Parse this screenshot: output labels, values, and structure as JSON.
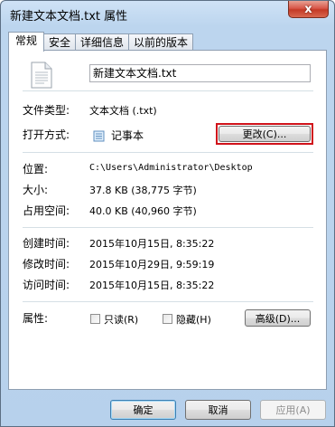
{
  "window": {
    "title": "新建文本文档.txt 属性",
    "close_glyph": "x"
  },
  "tabs": [
    {
      "label": "常规",
      "active": true
    },
    {
      "label": "安全"
    },
    {
      "label": "详细信息"
    },
    {
      "label": "以前的版本"
    }
  ],
  "general": {
    "file_name": "新建文本文档.txt",
    "file_type_label": "文件类型:",
    "file_type_value": "文本文档 (.txt)",
    "open_with_label": "打开方式:",
    "open_with_value": "记事本",
    "change_button": "更改(C)...",
    "location_label": "位置:",
    "location_value": "C:\\Users\\Administrator\\Desktop",
    "size_label": "大小:",
    "size_value": "37.8 KB (38,775 字节)",
    "disk_size_label": "占用空间:",
    "disk_size_value": "40.0 KB (40,960 字节)",
    "created_label": "创建时间:",
    "created_value": "2015年10月15日, 8:35:22",
    "modified_label": "修改时间:",
    "modified_value": "2015年10月29日, 9:59:19",
    "accessed_label": "访问时间:",
    "accessed_value": "2015年10月15日, 8:35:22",
    "attributes_label": "属性:",
    "readonly_label": "只读(R)",
    "readonly_checked": false,
    "hidden_label": "隐藏(H)",
    "hidden_checked": false,
    "advanced_button": "高级(D)..."
  },
  "footer": {
    "ok": "确定",
    "cancel": "取消",
    "apply": "应用(A)"
  },
  "colors": {
    "highlight_border": "#d0131b",
    "close_button": "#c43a26"
  }
}
